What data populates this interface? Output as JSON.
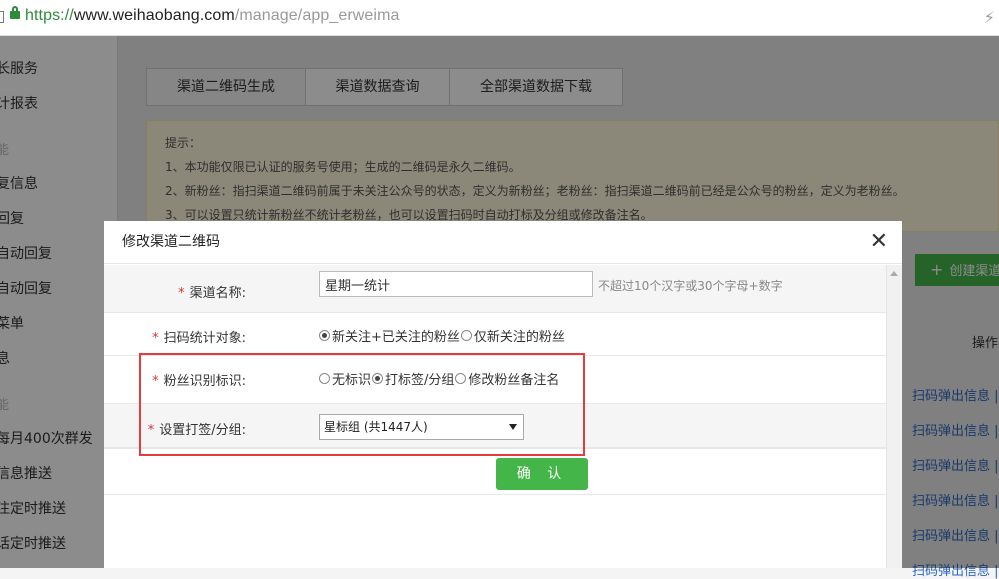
{
  "browser": {
    "url_scheme": "https://",
    "url_host": "www.weihaobang.com",
    "url_path": "/manage/app_erweima"
  },
  "sidebar": {
    "items": [
      "长服务",
      "计报表",
      "能",
      "复信息",
      "回复",
      "自动回复",
      "自动回复",
      "菜单",
      "息",
      "能",
      "每月400次群发",
      "信息推送",
      "注定时推送",
      "话定时推送"
    ]
  },
  "main": {
    "tabs": [
      "渠道二维码生成",
      "渠道数据查询",
      "全部渠道数据下载"
    ],
    "tips": [
      "提示：",
      "1、本功能仅限已认证的服务号使用；生成的二维码是永久二维码。",
      "2、新粉丝：指扫渠道二维码前属于未关注公众号的状态，定义为新粉丝；老粉丝：指扫渠道二维码前已经是公众号的粉丝，定义为老粉丝。",
      "3、可以设置只统计新粉丝不统计老粉丝，也可以设置扫码时自动打标及分组或修改备注名。"
    ],
    "create_button": "创建渠道",
    "op_header": "操作",
    "row_link": "扫码弹出信息 |"
  },
  "modal": {
    "title": "修改渠道二维码",
    "channel_name": {
      "label": "渠道名称:",
      "value": "星期一统计",
      "hint": "不超过10个汉字或30个字母+数字"
    },
    "scan_target": {
      "label": "扫码统计对象:",
      "options": [
        "新关注+已关注的粉丝",
        "仅新关注的粉丝"
      ],
      "selected": 0
    },
    "fan_mark": {
      "label": "粉丝识别标识:",
      "options": [
        "无标识",
        "打标签/分组",
        "修改粉丝备注名"
      ],
      "selected": 1
    },
    "tag_group": {
      "label": "设置打签/分组:",
      "value": "星标组  (共1447人)"
    },
    "confirm": "确 认"
  }
}
